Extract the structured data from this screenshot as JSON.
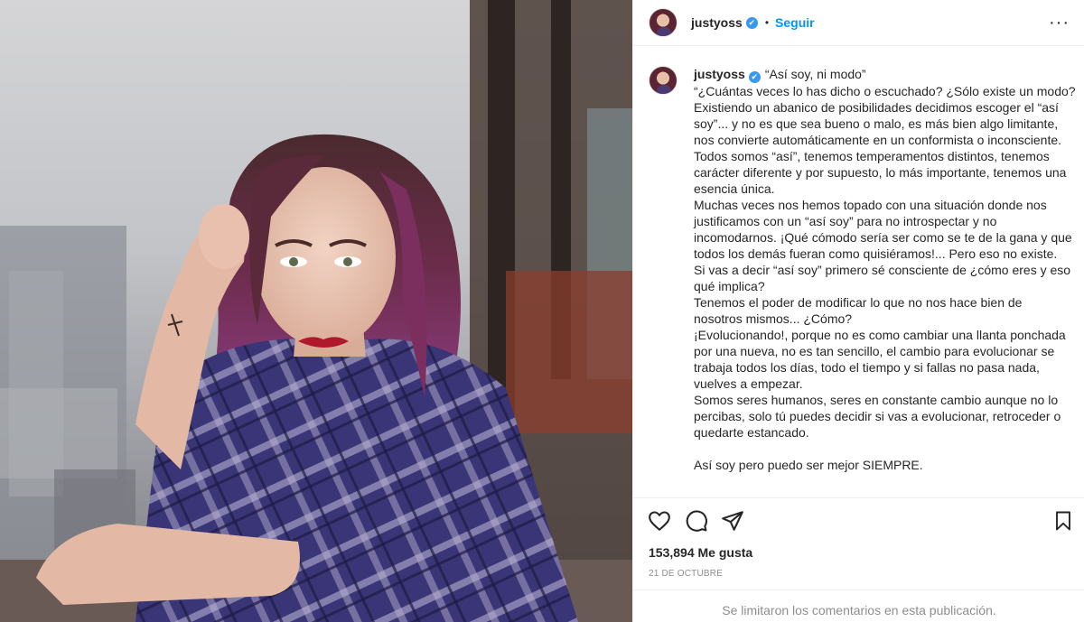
{
  "post": {
    "username": "justyoss",
    "verified_mark": "✔",
    "separator": "•",
    "follow_label": "Seguir",
    "more_label": "···",
    "photo_icon": "portrait-photo",
    "caption_lines": [
      "“¿Cuántas veces lo has dicho o escuchado? ¿Sólo existe un modo?",
      "Existiendo un abanico de posibilidades decidimos escoger el “así",
      "soy”... y no es que sea bueno o malo, es más bien algo limitante,",
      "nos convierte automáticamente en un conformista o inconsciente.",
      "Todos somos “así”, tenemos temperamentos distintos, tenemos",
      "carácter diferente y por supuesto, lo más importante, tenemos una",
      "esencia única.",
      "Muchas veces nos hemos topado con una situación donde nos",
      "justificamos con un “así soy” para no introspectar y no",
      "incomodarnos. ¡Qué cómodo sería ser como se te de la gana y que",
      "todos los demás fueran como quisiéramos!... Pero eso no existe.",
      "Si vas a decir “así soy” primero sé consciente de ¿cómo eres y eso",
      "qué implica?",
      "Tenemos el poder de modificar lo que no nos hace bien de",
      "nosotros mismos... ¿Cómo?",
      "¡Evolucionando!, porque no es como cambiar una llanta ponchada",
      "por una nueva, no es tan sencillo, el cambio para evolucionar se",
      "trabaja todos los días, todo el tiempo y si fallas no pasa nada,",
      "vuelves a empezar.",
      "Somos seres humanos, seres en constante cambio aunque no lo",
      "percibas, solo tú puedes decidir si vas a evolucionar, retroceder o",
      "quedarte estancado."
    ],
    "caption_first": "“Así soy, ni modo”",
    "caption_closing": "Así soy pero puedo ser mejor SIEMPRE.",
    "likes_count": "153,894",
    "likes_label": "Me gusta",
    "date": "21 DE OCTUBRE",
    "comments_note": "Se limitaron los comentarios en esta publicación.",
    "icons": {
      "like": "heart-icon",
      "comment": "comment-icon",
      "share": "send-icon",
      "save": "bookmark-icon",
      "more": "more-options-icon",
      "verified": "verified-badge-icon"
    },
    "colors": {
      "accent": "#0095f6",
      "verified": "#3897f0",
      "text": "#262626",
      "muted": "#8e8e8e"
    }
  }
}
